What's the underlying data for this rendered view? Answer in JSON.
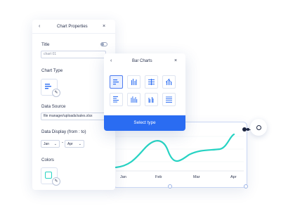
{
  "panel": {
    "title": "Chart Properties",
    "back_icon": "chevron-left-icon",
    "close_icon": "close-icon",
    "title_label": "Title",
    "title_value": "chart 01",
    "chart_type_label": "Chart Type",
    "data_source_label": "Data Source",
    "data_source_value": "file manager/uploads/sales.xlsx",
    "data_display_label": "Data Display (from : to)",
    "from_value": "Jan",
    "range_sep": "-",
    "to_value": "Apr",
    "colors_label": "Colors",
    "accent": "#2a6cf2",
    "color_swatch": "#27d3c3"
  },
  "bar_popup": {
    "title": "Bar Charts",
    "select_button": "Select type",
    "tiles": [
      "bar-horizontal",
      "bar-vertical-grouped",
      "bar-vertical-stacked",
      "bar-vertical-mixed",
      "bar-horizontal-stacked",
      "bar-vertical-thin",
      "bar-vertical-grouped-2",
      "bar-horizontal-thin"
    ]
  },
  "chart": {
    "type": "line",
    "x_ticks": [
      "Jan",
      "Feb",
      "Mar",
      "Apr"
    ],
    "line_color": "#27d3c3"
  }
}
